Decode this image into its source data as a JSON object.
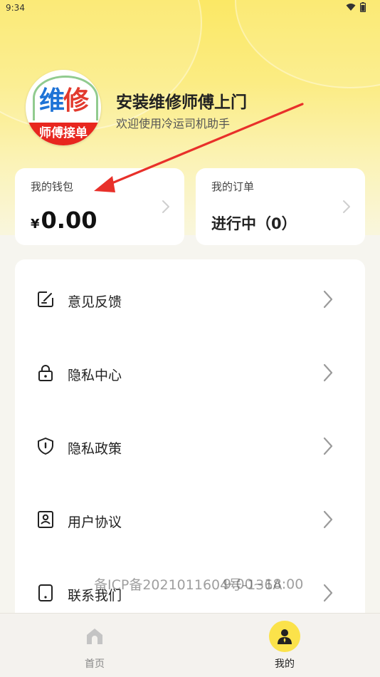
{
  "status_bar": {
    "time": "9:34"
  },
  "profile": {
    "avatar_top_char1": "维",
    "avatar_top_char2": "修",
    "avatar_bottom_text": "师傅接单",
    "title": "安装维修师傅上门",
    "subtitle": "欢迎使用冷运司机助手"
  },
  "wallet": {
    "label": "我的钱包",
    "currency": "¥",
    "amount": "0.00"
  },
  "orders": {
    "label": "我的订单",
    "status": "进行中（0）"
  },
  "menu": {
    "items": [
      {
        "label": "意见反馈",
        "icon": "feedback-edit-icon"
      },
      {
        "label": "隐私中心",
        "icon": "lock-icon"
      },
      {
        "label": "隐私政策",
        "icon": "shield-icon"
      },
      {
        "label": "用户协议",
        "icon": "user-document-icon"
      },
      {
        "label": "联系我们",
        "icon": "phone-icon"
      }
    ]
  },
  "footer": {
    "icp": "备ICP备2021011604号-136A",
    "hours": "9:00~18:00"
  },
  "tabbar": {
    "tabs": [
      {
        "label": "首页",
        "icon": "home-icon",
        "active": false
      },
      {
        "label": "我的",
        "icon": "user-profile-icon",
        "active": true
      }
    ]
  },
  "colors": {
    "accent_yellow": "#fbe24a",
    "annotation_arrow": "#e8302a"
  }
}
